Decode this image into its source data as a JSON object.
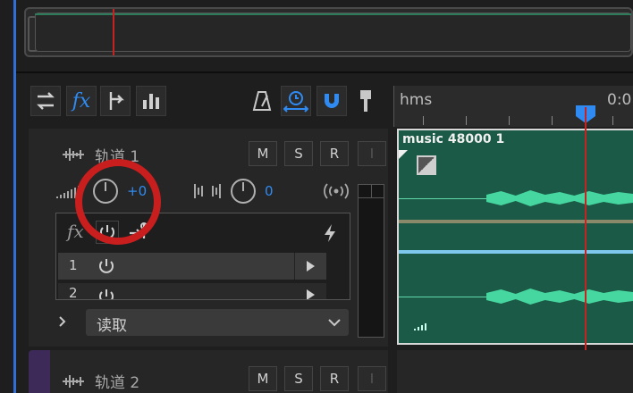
{
  "ruler": {
    "unit_label": "hms",
    "time_label": "0:0"
  },
  "tracks": [
    {
      "name": "轨道 1",
      "m": "M",
      "s": "S",
      "r": "R",
      "i": "I",
      "volume": "+0",
      "pan": "0",
      "fx_label": "fx",
      "slot_number": "1",
      "slot_number_2": "2",
      "automation": "读取"
    },
    {
      "name": "轨道 2",
      "m": "M",
      "s": "S",
      "r": "R",
      "i": "I"
    }
  ],
  "clip": {
    "name": "music 48000 1",
    "color": "#1a5a46"
  },
  "colors": {
    "accent": "#2f8bf2",
    "track1": "#1fbb7e",
    "track2": "#3e2a58",
    "playhead": "#c62222",
    "annotation": "#c81e1e"
  }
}
